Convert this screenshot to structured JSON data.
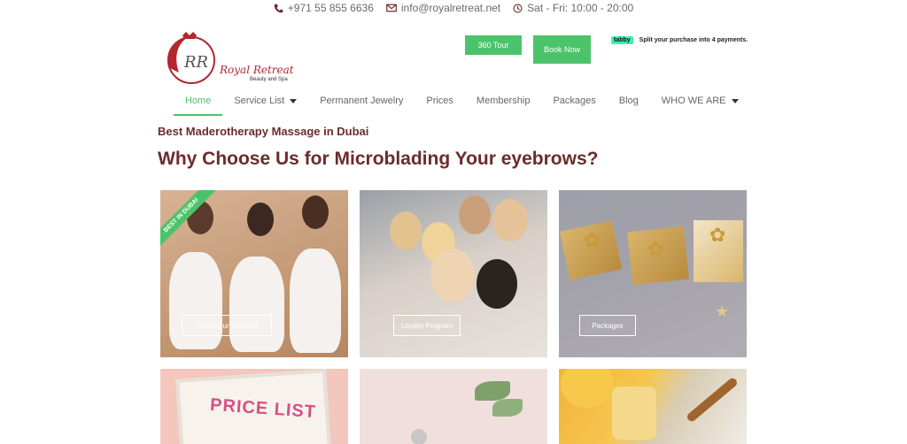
{
  "topbar": {
    "phone": "+971 55 855 6636",
    "email": "info@royalretreat.net",
    "hours": "Sat - Fri: 10:00 - 20:00"
  },
  "brand": {
    "name": "Royal Retreat",
    "tagline": "Beauty and Spa",
    "monogram": "RR",
    "color": "#b3272d"
  },
  "header": {
    "tour_label": "360 Tour",
    "book_label": "Book Now",
    "tabby_badge": "tabby",
    "tabby_text": "Split your purchase into 4 payments."
  },
  "nav": {
    "items": [
      {
        "label": "Home",
        "active": true
      },
      {
        "label": "Service List",
        "dropdown": true
      },
      {
        "label": "Permanent Jewelry"
      },
      {
        "label": "Prices"
      },
      {
        "label": "Membership"
      },
      {
        "label": "Packages"
      },
      {
        "label": "Blog"
      },
      {
        "label": "WHO WE ARE",
        "dropdown": true
      }
    ]
  },
  "content": {
    "subheading": "Best Maderotherapy Massage in Dubai",
    "heading": "Why Choose Us for Microblading Your eyebrows?"
  },
  "cards": [
    {
      "button": "Check Our Services",
      "ribbon": "BEST IN DUBAI"
    },
    {
      "button": "Loyalty Program"
    },
    {
      "button": "Packages"
    },
    {
      "sign": "PRICE LIST"
    },
    {},
    {}
  ],
  "colors": {
    "accent_green": "#4cc36a",
    "heading_maroon": "#6b2c2c",
    "tabby_green": "#3bf0b0"
  },
  "icons": [
    "phone-icon",
    "envelope-icon",
    "clock-icon",
    "caret-down-icon"
  ]
}
